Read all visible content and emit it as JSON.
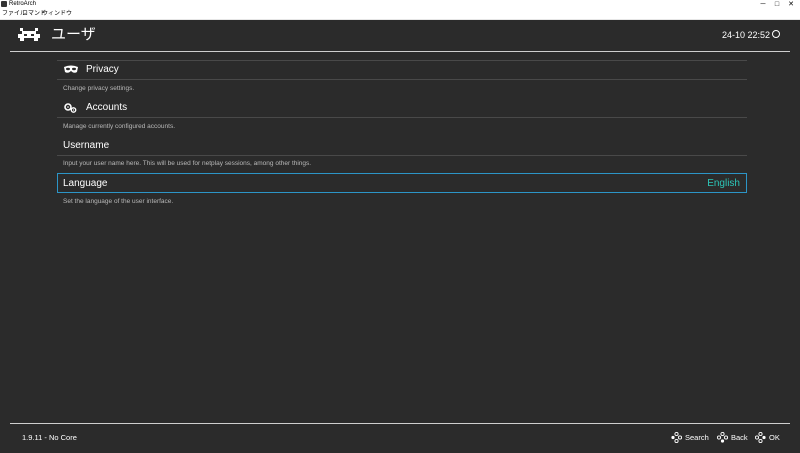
{
  "window": {
    "title": "RetroArch",
    "menu": [
      "ファイル",
      "コマンド",
      "ウィンドウ"
    ],
    "buttons": {
      "minimize": "─",
      "maximize": "□",
      "close": "✕"
    }
  },
  "header": {
    "title": "ユーザ",
    "clock": "24-10 22:52"
  },
  "items": [
    {
      "label": "Privacy",
      "icon": "mask-icon",
      "description": "Change privacy settings.",
      "value": ""
    },
    {
      "label": "Accounts",
      "icon": "gears-icon",
      "description": "Manage currently configured accounts.",
      "value": ""
    },
    {
      "label": "Username",
      "icon": "",
      "description": "Input your user name here. This will be used for netplay sessions, among other things.",
      "value": ""
    },
    {
      "label": "Language",
      "icon": "",
      "description": "Set the language of the user interface.",
      "value": "English"
    }
  ],
  "footer": {
    "version": "1.9.11 - No Core",
    "buttons": [
      {
        "label": "Search",
        "icon": "gamepad-icon"
      },
      {
        "label": "Back",
        "icon": "gamepad-icon"
      },
      {
        "label": "OK",
        "icon": "gamepad-icon"
      }
    ]
  },
  "colors": {
    "background": "#2b2b2b",
    "value_accent": "#2cc6b8",
    "selection_border": "#2c95c7"
  }
}
